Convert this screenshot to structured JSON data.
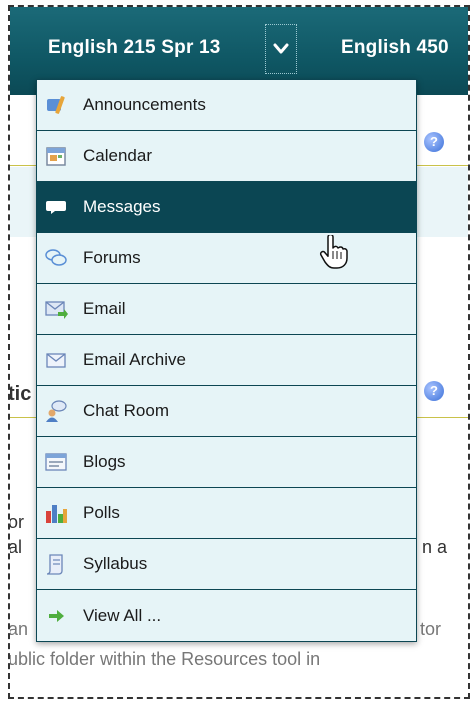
{
  "nav": {
    "site_tabs": [
      {
        "label": "English 215 Spr 13"
      },
      {
        "label": "English 450"
      }
    ]
  },
  "menu": {
    "items": [
      {
        "label": "Announcements",
        "icon": "announcements-icon"
      },
      {
        "label": "Calendar",
        "icon": "calendar-icon"
      },
      {
        "label": "Messages",
        "icon": "messages-icon",
        "active": true
      },
      {
        "label": "Forums",
        "icon": "forums-icon"
      },
      {
        "label": "Email",
        "icon": "email-icon"
      },
      {
        "label": "Email Archive",
        "icon": "email-archive-icon"
      },
      {
        "label": "Chat Room",
        "icon": "chat-room-icon"
      },
      {
        "label": "Blogs",
        "icon": "blogs-icon"
      },
      {
        "label": "Polls",
        "icon": "polls-icon"
      },
      {
        "label": "Syllabus",
        "icon": "syllabus-icon"
      },
      {
        "label": "View All ...",
        "icon": "arrow-right-icon"
      }
    ]
  },
  "background": {
    "fragment_1": "tic",
    "fragment_2": "or",
    "fragment_3": "al",
    "fragment_4": "n a",
    "fragment_5": "an",
    "fragment_6": "tor",
    "fragment_7": "ublic folder within the Resources tool in"
  },
  "colors": {
    "topbar": "#0f5764",
    "menu_bg": "#e6f4f7",
    "active_bg": "#0b4653",
    "accent_line": "#c9c24a"
  }
}
